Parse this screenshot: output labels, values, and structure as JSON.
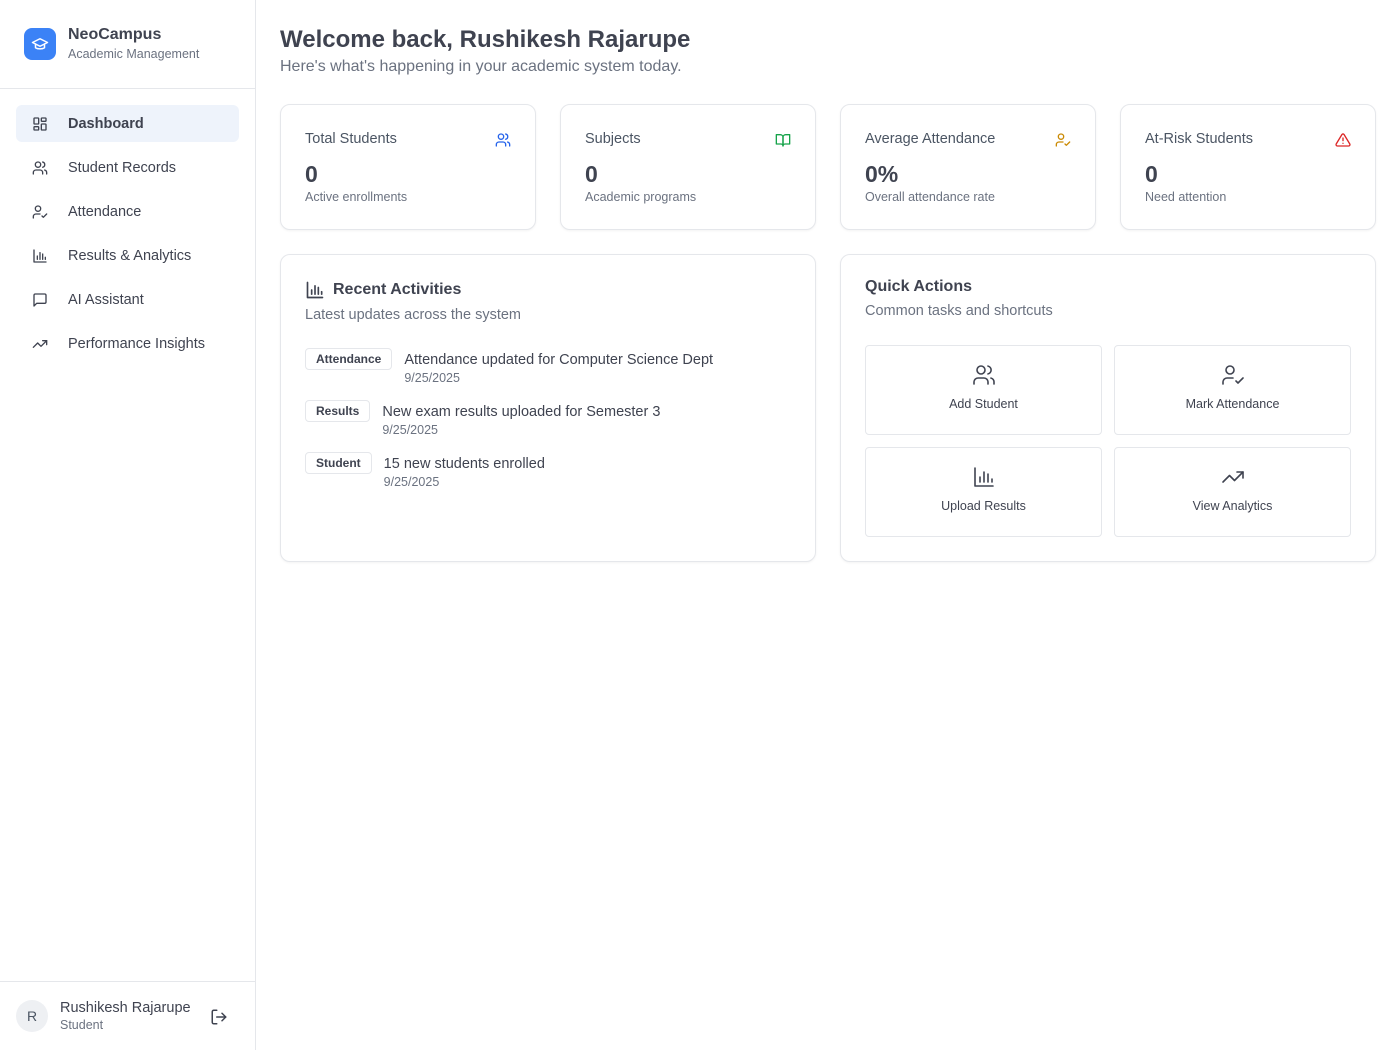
{
  "brand": {
    "name": "NeoCampus",
    "subtitle": "Academic Management",
    "logo_icon": "graduation-cap-icon",
    "color": "#3b82f6"
  },
  "nav": [
    {
      "label": "Dashboard",
      "icon": "dashboard-grid-icon",
      "active": true
    },
    {
      "label": "Student Records",
      "icon": "users-icon"
    },
    {
      "label": "Attendance",
      "icon": "user-check-icon"
    },
    {
      "label": "Results & Analytics",
      "icon": "bar-chart-icon"
    },
    {
      "label": "AI Assistant",
      "icon": "message-square-icon"
    },
    {
      "label": "Performance Insights",
      "icon": "trending-up-icon"
    }
  ],
  "user": {
    "initial": "R",
    "name": "Rushikesh Rajarupe",
    "role": "Student"
  },
  "header": {
    "title": "Welcome back, Rushikesh Rajarupe",
    "subtitle": "Here's what's happening in your academic system today."
  },
  "stats": [
    {
      "label": "Total Students",
      "value": "0",
      "desc": "Active enrollments",
      "icon": "users-icon",
      "color": "#2563eb"
    },
    {
      "label": "Subjects",
      "value": "0",
      "desc": "Academic programs",
      "icon": "book-open-icon",
      "color": "#16a34a"
    },
    {
      "label": "Average Attendance",
      "value": "0%",
      "desc": "Overall attendance rate",
      "icon": "user-check-icon",
      "color": "#ca8a04"
    },
    {
      "label": "At-Risk Students",
      "value": "0",
      "desc": "Need attention",
      "icon": "alert-triangle-icon",
      "color": "#dc2626"
    }
  ],
  "recent": {
    "title": "Recent Activities",
    "subtitle": "Latest updates across the system",
    "items": [
      {
        "badge": "Attendance",
        "text": "Attendance updated for Computer Science Dept",
        "date": "9/25/2025"
      },
      {
        "badge": "Results",
        "text": "New exam results uploaded for Semester 3",
        "date": "9/25/2025"
      },
      {
        "badge": "Student",
        "text": "15 new students enrolled",
        "date": "9/25/2025"
      }
    ]
  },
  "quick": {
    "title": "Quick Actions",
    "subtitle": "Common tasks and shortcuts",
    "actions": [
      {
        "label": "Add Student",
        "icon": "users-icon"
      },
      {
        "label": "Mark Attendance",
        "icon": "user-check-icon"
      },
      {
        "label": "Upload Results",
        "icon": "bar-chart-icon"
      },
      {
        "label": "View Analytics",
        "icon": "trending-up-icon"
      }
    ]
  }
}
